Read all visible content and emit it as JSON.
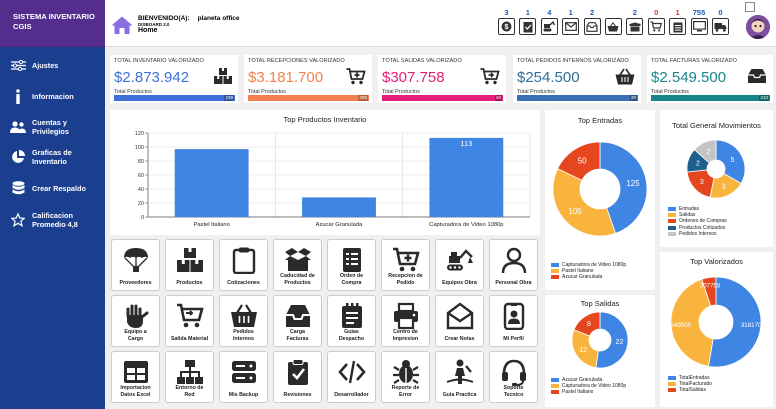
{
  "sidebar": {
    "title_line1": "SISTEMA INVENTARIO",
    "title_line2": "CGIS",
    "items": [
      {
        "line1": "Ajustes",
        "line2": ""
      },
      {
        "line1": "Informacion",
        "line2": ""
      },
      {
        "line1": "Cuentas y",
        "line2": "Privilegios"
      },
      {
        "line1": "Graficas de",
        "line2": "Inventario"
      },
      {
        "line1": "Crear Respaldo",
        "line2": ""
      },
      {
        "line1": "Calificacion",
        "line2": "Promedio 4,8"
      }
    ]
  },
  "header": {
    "welcome_label": "BIENVENIDO(A):",
    "user_name": "planeta office",
    "dashboard_version": "DISBOARD 2.0",
    "breadcrumb": "Home",
    "toolbar_counts": [
      "3",
      "1",
      "4",
      "1",
      "2",
      "",
      "2",
      "0",
      "1",
      "755",
      "0"
    ]
  },
  "kpis": [
    {
      "label": "TOTAL INVENTARIO VALORIZADO",
      "value": "$2.873.942",
      "sub": "Total Productos",
      "count": "239",
      "color": "#3f6fd8",
      "value_color": "#3f6fd8"
    },
    {
      "label": "TOTAL RECEPCIONES VALORIZADO",
      "value": "$3.181.700",
      "sub": "Total Productos",
      "count": "280",
      "color": "#f57f4e",
      "value_color": "#f57f4e"
    },
    {
      "label": "TOTAL SALIDAS VALORIZADO",
      "value": "$307.758",
      "sub": "Total Productos",
      "count": "40",
      "color": "#e61d78",
      "value_color": "#e61d78"
    },
    {
      "label": "TOTAL PEDIDOS INTERNOS VALORIZADO",
      "value": "$254.500",
      "sub": "Total Productos",
      "count": "20",
      "color": "#3a6fb5",
      "value_color": "#2e6f9a"
    },
    {
      "label": "TOTAL FACTURAS VALORIZADO",
      "value": "$2.549.500",
      "sub": "Total Productos",
      "count": "210",
      "color": "#17868a",
      "value_color": "#17868a"
    }
  ],
  "charts": {
    "bar_title": "Top Productos Inventario",
    "top_entradas_title": "Top Entradas",
    "top_salidas_title": "Top Salidas",
    "mov_title": "Total General Movimientos",
    "valorizados_title": "Top Valorizados"
  },
  "chart_data": [
    {
      "type": "bar",
      "title": "Top Productos Inventario",
      "categories": [
        "Pastel Italiano",
        "Azucar Granulada",
        "Capturadora de Video 1080p"
      ],
      "values": [
        97,
        28,
        113
      ],
      "data_labels": [
        "",
        "",
        "113"
      ],
      "ylim": [
        0,
        120
      ],
      "yticks": [
        0,
        20,
        40,
        60,
        80,
        100,
        120
      ],
      "color": "#3f86e4",
      "grid": true
    },
    {
      "type": "pie",
      "title": "Top Entradas",
      "labels": [
        "Capturadora de Video 1080p",
        "Pastel Italiano",
        "Azucar Granulada"
      ],
      "values": [
        125,
        105,
        50
      ],
      "colors": [
        "#3f86e4",
        "#f9b43d",
        "#e5461d"
      ],
      "legend": "bottom-left"
    },
    {
      "type": "pie",
      "title": "Top Salidas",
      "labels": [
        "Azucar Granulada",
        "Capturadora de Video 1080p",
        "Pastel Italiano"
      ],
      "values": [
        22,
        12,
        8
      ],
      "colors": [
        "#3f86e4",
        "#f9b43d",
        "#e5461d"
      ],
      "legend": "bottom-left"
    },
    {
      "type": "pie",
      "title": "Total General Movimientos",
      "labels": [
        "Entradas",
        "Salidas",
        "Ordenes de Compras",
        "Productos Cotizados",
        "Pedidos Internos"
      ],
      "values": [
        5,
        3,
        3,
        2,
        2
      ],
      "colors": [
        "#3f86e4",
        "#f9b43d",
        "#e5461d",
        "#1f5f8b",
        "#c4c4c4"
      ],
      "legend": "bottom-left"
    },
    {
      "type": "pie",
      "title": "Top Valorizados",
      "labels": [
        "TotalEntradas",
        "TotalFacturado",
        "TotalSalidas"
      ],
      "values": [
        3181700,
        2549500,
        307758
      ],
      "colors": [
        "#3f86e4",
        "#f9b43d",
        "#e5461d"
      ],
      "legend": "bottom-left"
    }
  ],
  "tiles": [
    {
      "line1": "Proveedores",
      "line2": "",
      "icon": "parachute-icon"
    },
    {
      "line1": "Productos",
      "line2": "",
      "icon": "boxes-icon"
    },
    {
      "line1": "Cotizaciones",
      "line2": "",
      "icon": "clipboard-icon"
    },
    {
      "line1": "Caducidad de",
      "line2": "Productos",
      "icon": "open-box-icon"
    },
    {
      "line1": "Orden de",
      "line2": "Compra",
      "icon": "document-list-icon"
    },
    {
      "line1": "Recepcion de",
      "line2": "Pedido",
      "icon": "cart-plus-icon"
    },
    {
      "line1": "Equipos Obra",
      "line2": "",
      "icon": "excavator-icon"
    },
    {
      "line1": "Personal Obra",
      "line2": "",
      "icon": "person-icon"
    },
    {
      "line1": "Equipo a",
      "line2": "Cargo",
      "icon": "hand-icon"
    },
    {
      "line1": "Salida Material",
      "line2": "",
      "icon": "cart-icon"
    },
    {
      "line1": "Pedidos",
      "line2": "Internos",
      "icon": "basket-icon"
    },
    {
      "line1": "Carga",
      "line2": "Facturas",
      "icon": "inbox-icon"
    },
    {
      "line1": "Guias",
      "line2": "Despacho",
      "icon": "notepad-icon"
    },
    {
      "line1": "Centro de",
      "line2": "Impresion",
      "icon": "printer-icon"
    },
    {
      "line1": "Crear Notas",
      "line2": "",
      "icon": "envelope-icon"
    },
    {
      "line1": "Mi Perfil",
      "line2": "",
      "icon": "id-badge-icon"
    },
    {
      "line1": "Importacion",
      "line2": "Datos Excel",
      "icon": "table-icon"
    },
    {
      "line1": "Entorno de",
      "line2": "Red",
      "icon": "network-icon"
    },
    {
      "line1": "Mis Backup",
      "line2": "",
      "icon": "server-icon"
    },
    {
      "line1": "Revisiones",
      "line2": "",
      "icon": "clipboard-check-icon"
    },
    {
      "line1": "Desarrollador",
      "line2": "",
      "icon": "code-icon"
    },
    {
      "line1": "Reporte de",
      "line2": "Error",
      "icon": "bug-icon"
    },
    {
      "line1": "Guia Practica",
      "line2": "",
      "icon": "guide-icon"
    },
    {
      "line1": "Soporte",
      "line2": "Tecnico",
      "icon": "headset-icon"
    }
  ]
}
